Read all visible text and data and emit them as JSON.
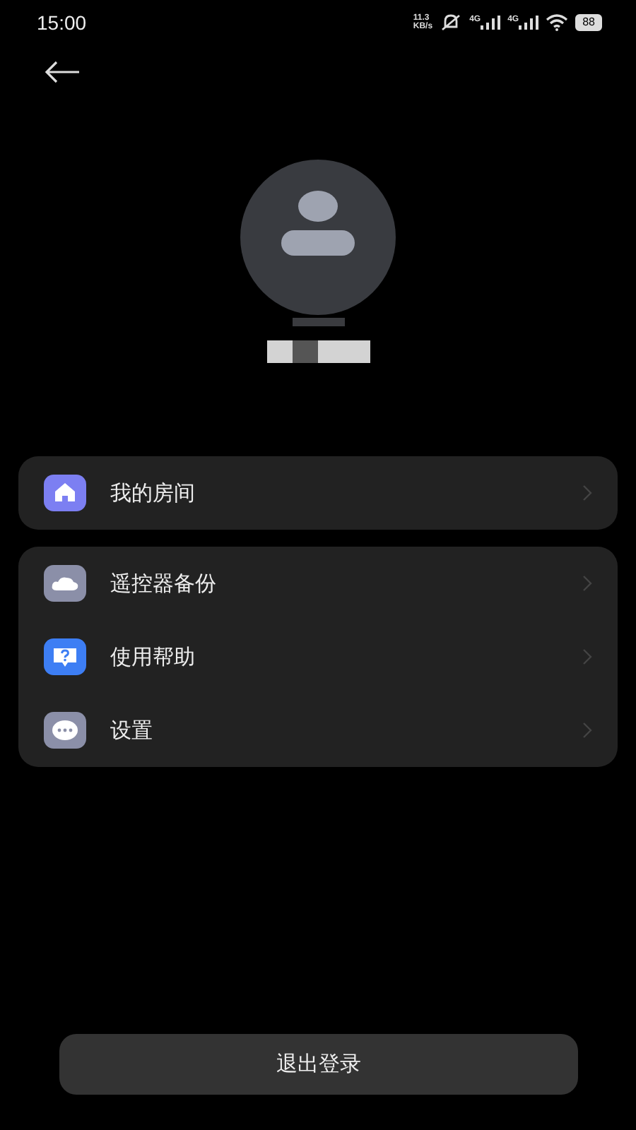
{
  "status_bar": {
    "time": "15:00",
    "speed": [
      "11.3",
      "KB/s"
    ],
    "signals": [
      "4G",
      "4G"
    ],
    "battery": "88"
  },
  "groups": [
    {
      "items": [
        {
          "label": "我的房间",
          "color": "#7c7ff2"
        }
      ]
    },
    {
      "items": [
        {
          "label": "遥控器备份",
          "color": "#8b8fa8"
        },
        {
          "label": "使用帮助",
          "color": "#3d7ef4"
        },
        {
          "label": "设置",
          "color": "#8b8fa8"
        }
      ]
    }
  ],
  "logout_button": "退出登录"
}
